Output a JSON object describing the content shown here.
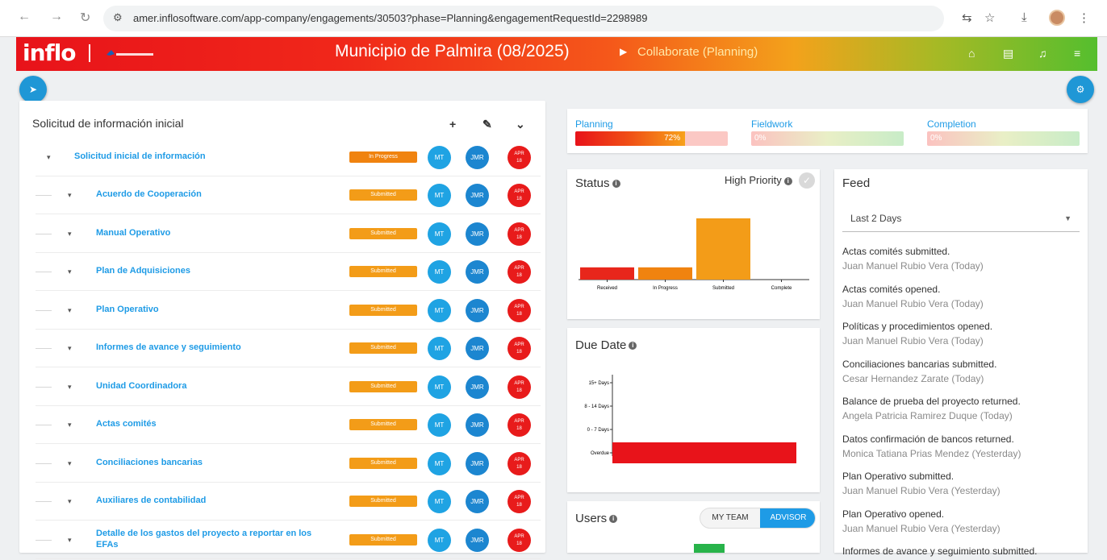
{
  "browser": {
    "url": "amer.inflosoftware.com/app-company/engagements/30503?phase=Planning&engagementRequestId=2298989"
  },
  "header": {
    "logo": "inflo",
    "title": "Municipio de Palmira (08/2025)",
    "crumb": "Collaborate (Planning)"
  },
  "left_panel": {
    "title": "Solicitud de información inicial",
    "root": {
      "label": "Solicitud inicial de información",
      "status": "In Progress",
      "badges": [
        "MT",
        "JMR",
        "APR 18"
      ]
    },
    "items": [
      {
        "label": "Acuerdo de Cooperación",
        "status": "Submitted"
      },
      {
        "label": "Manual Operativo",
        "status": "Submitted"
      },
      {
        "label": "Plan de Adquisiciones",
        "status": "Submitted"
      },
      {
        "label": "Plan Operativo",
        "status": "Submitted"
      },
      {
        "label": "Informes de avance y seguimiento",
        "status": "Submitted"
      },
      {
        "label": "Unidad Coordinadora",
        "status": "Submitted"
      },
      {
        "label": "Actas comités",
        "status": "Submitted"
      },
      {
        "label": "Conciliaciones bancarias",
        "status": "Submitted"
      },
      {
        "label": "Auxiliares de contabilidad",
        "status": "Submitted"
      },
      {
        "label": "Detalle de los gastos del proyecto a reportar en los EFAs",
        "status": "Submitted"
      }
    ],
    "badge_mt": "MT",
    "badge_jmr": "JMR",
    "badge_app1": "APR",
    "badge_app2": "18"
  },
  "phases": [
    {
      "label": "Planning",
      "pct": "72%",
      "value": 72
    },
    {
      "label": "Fieldwork",
      "pct": "0%",
      "value": 0
    },
    {
      "label": "Completion",
      "pct": "0%",
      "value": 0
    }
  ],
  "status_card": {
    "title": "Status",
    "priority_label": "High Priority"
  },
  "due_card": {
    "title": "Due Date"
  },
  "users_card": {
    "title": "Users",
    "toggle_a": "MY TEAM",
    "toggle_b": "ADVISOR"
  },
  "feed": {
    "title": "Feed",
    "filter": "Last 2 Days",
    "items": [
      {
        "text": "Actas comités submitted.",
        "sub": "Juan Manuel Rubio Vera (Today)"
      },
      {
        "text": "Actas comités opened.",
        "sub": "Juan Manuel Rubio Vera (Today)"
      },
      {
        "text": "Políticas y procedimientos opened.",
        "sub": "Juan Manuel Rubio Vera (Today)"
      },
      {
        "text": "Conciliaciones bancarias submitted.",
        "sub": "Cesar Hernandez Zarate (Today)"
      },
      {
        "text": "Balance de prueba del proyecto returned.",
        "sub": "Angela Patricia Ramirez Duque (Today)"
      },
      {
        "text": "Datos confirmación de bancos returned.",
        "sub": "Monica Tatiana Prias Mendez (Yesterday)"
      },
      {
        "text": "Plan Operativo submitted.",
        "sub": "Juan Manuel Rubio Vera (Yesterday)"
      },
      {
        "text": "Plan Operativo opened.",
        "sub": "Juan Manuel Rubio Vera (Yesterday)"
      },
      {
        "text": "Informes de avance y seguimiento submitted.",
        "sub": ""
      }
    ]
  },
  "chart_data": [
    {
      "type": "bar",
      "categories": [
        "Received",
        "In Progress",
        "Submitted",
        "Complete"
      ],
      "values": [
        1,
        1,
        5,
        0
      ],
      "colors": [
        "#e8261b",
        "#f0830f",
        "#f39c18",
        "#f39c18"
      ],
      "title": "Status"
    },
    {
      "type": "bar",
      "orientation": "horizontal",
      "categories": [
        "15+ Days",
        "8 - 14 Days",
        "0 - 7 Days",
        "Overdue"
      ],
      "values": [
        0,
        0,
        0,
        11
      ],
      "colors": [
        "#e8131a"
      ],
      "title": "Due Date"
    }
  ]
}
